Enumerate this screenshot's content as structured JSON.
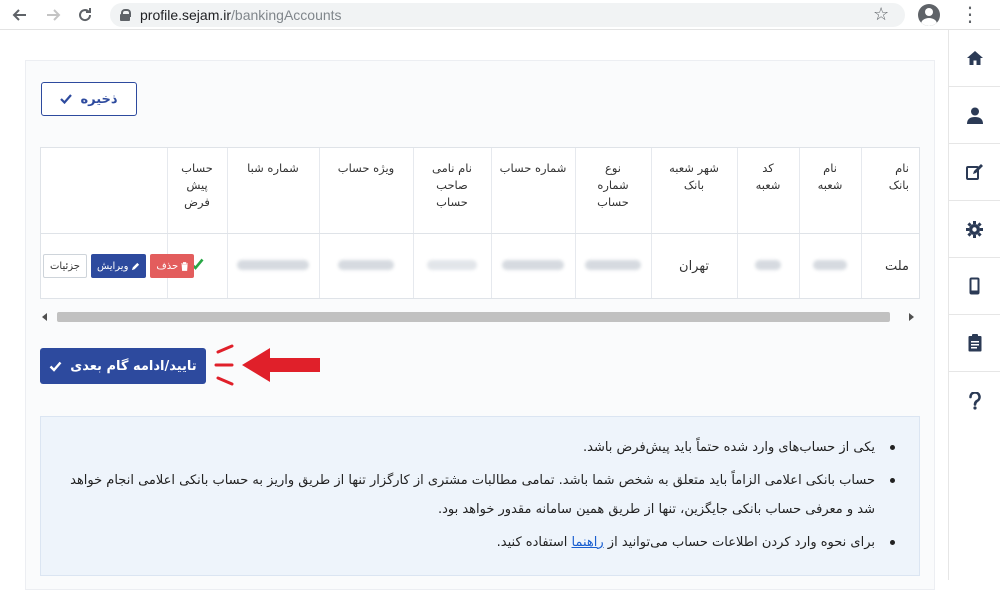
{
  "browser": {
    "url_host": "profile.sejam.ir",
    "url_path": "/bankingAccounts"
  },
  "toolbar": {
    "save_label": "ذخیره"
  },
  "table": {
    "headers": [
      "نام بانک",
      "نام شعبه",
      "کد شعبه",
      "شهر شعبه بانک",
      "نوع شماره حساب",
      "شماره حساب",
      "نام نامی صاحب حساب",
      "ویژه حساب",
      "شماره شبا",
      "حساب پیش فرض",
      ""
    ],
    "row": {
      "bank_name": "ملت",
      "branch_city": "تهران"
    },
    "actions": {
      "delete_label": "حذف",
      "edit_label": "ویرایش",
      "details_label": "جزئیات"
    }
  },
  "next_button_label": "تایید/ادامه گام بعدی",
  "info": {
    "item1": "یکی از حساب‌های وارد شده حتماً باید پیش‌فرض باشد.",
    "item2": "حساب بانکی اعلامی الزاماً باید متعلق به شخص شما باشد. تمامی مطالبات مشتری از کارگزار تنها از طریق واریز به حساب بانکی اعلامی انجام خواهد شد و معرفی حساب بانکی جایگزین، تنها از طریق همین سامانه مقدور خواهد بود.",
    "item3_pre": "برای نحوه وارد کردن اطلاعات حساب می‌توانید از",
    "item3_link": "راهنما",
    "item3_post": "استفاده کنید."
  },
  "colors": {
    "primary": "#2d4a9e",
    "danger": "#e35d5d",
    "success": "#28a745",
    "annotation": "#e0202a"
  }
}
